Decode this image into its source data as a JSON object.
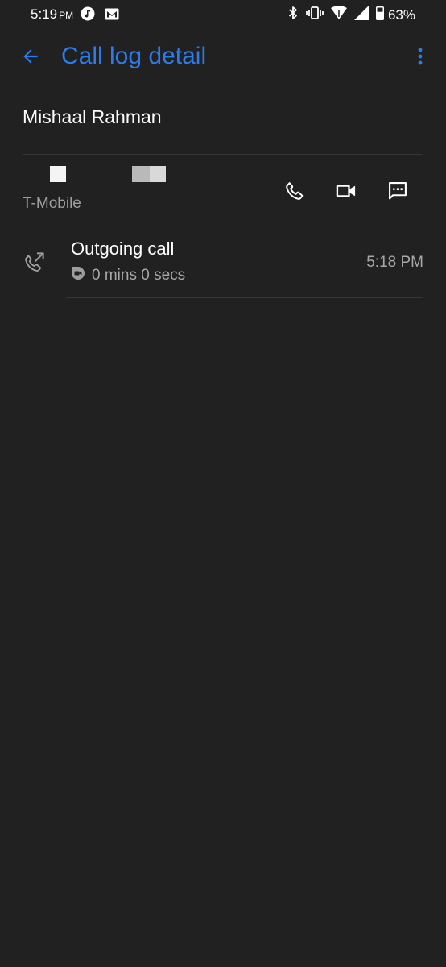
{
  "status_bar": {
    "time": "5:19",
    "ampm": "PM",
    "battery_percent": "63%",
    "battery_level": 0.63
  },
  "app_bar": {
    "title": "Call log detail"
  },
  "contact": {
    "name": "Mishaal Rahman",
    "carrier": "T-Mobile"
  },
  "call_log": [
    {
      "type": "Outgoing call",
      "duration": "0 mins 0 secs",
      "time": "5:18 PM"
    }
  ],
  "colors": {
    "background": "#212121",
    "accent": "#2d7be8",
    "secondary_text": "#a8a8a8",
    "divider": "#363636"
  },
  "icons": {
    "back": "arrow-left-icon",
    "overflow": "more-vert-icon",
    "call": "phone-icon",
    "video": "videocam-icon",
    "message": "sms-icon",
    "call_type": "call-made-icon",
    "duo": "duo-icon"
  }
}
